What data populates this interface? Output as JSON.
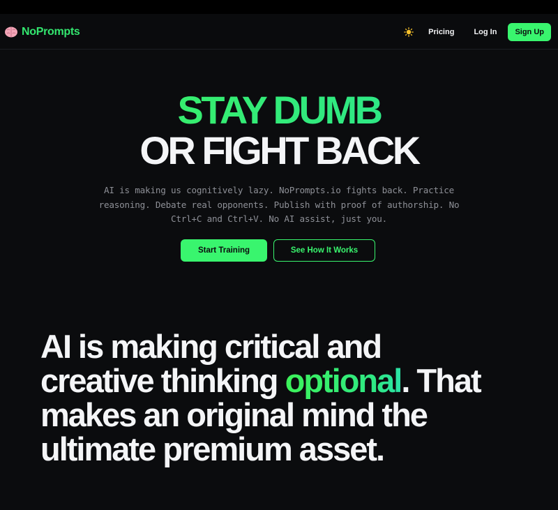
{
  "brand": {
    "name": "NoPrompts",
    "icon": "brain-icon",
    "color": "#33e66f"
  },
  "nav": {
    "theme_icon": "sun-icon",
    "pricing": "Pricing",
    "login": "Log In",
    "signup": "Sign Up"
  },
  "hero": {
    "line1": "STAY DUMB",
    "line2": "OR FIGHT BACK",
    "description": "AI is making us cognitively lazy. NoPrompts.io fights back. Practice reasoning. Debate real opponents. Publish with proof of authorship. No Ctrl+C and Ctrl+V. No AI assist, just you.",
    "primary_cta": "Start Training",
    "secondary_cta": "See How It Works"
  },
  "manifesto": {
    "before_accent": "AI is making critical and creative thinking ",
    "accent": "optional",
    "after_accent": ". That makes an original mind the ultimate premium asset."
  },
  "colors": {
    "background": "#0b0c0e",
    "accent_green": "#39f56e",
    "text_primary": "#f4f5f7",
    "text_muted": "#8e9097"
  }
}
